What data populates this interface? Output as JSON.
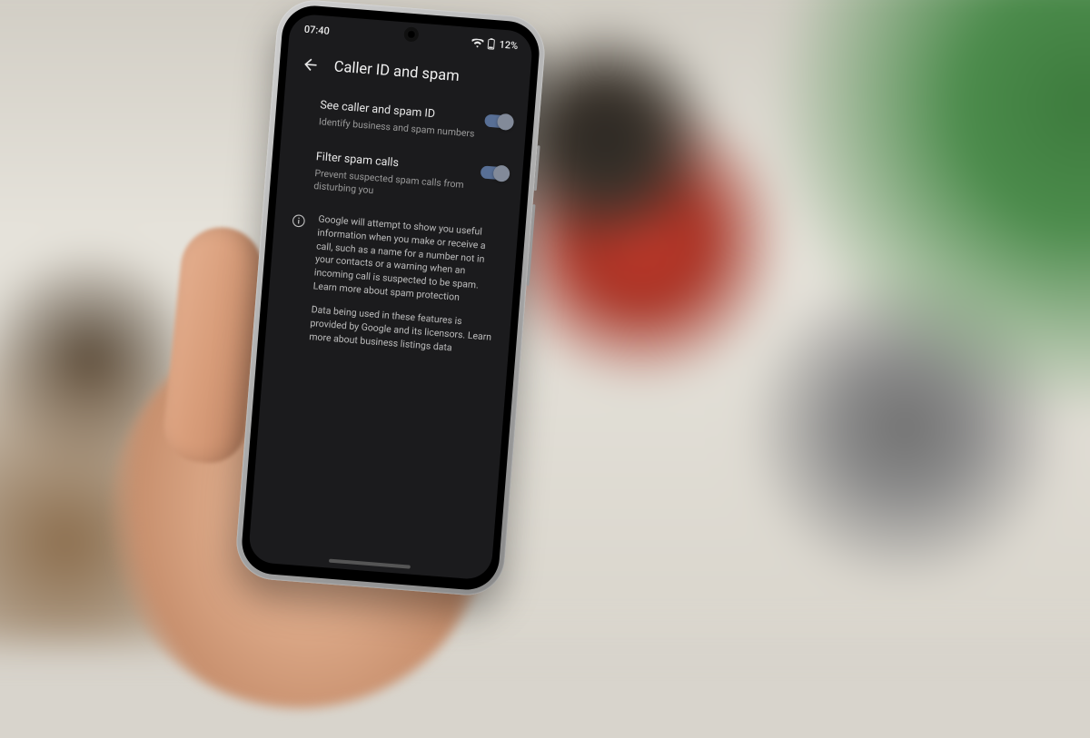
{
  "statusbar": {
    "time": "07:40",
    "battery_text": "12%"
  },
  "header": {
    "title": "Caller ID and spam"
  },
  "settings": [
    {
      "title": "See caller and spam ID",
      "subtitle": "Identify business and spam numbers",
      "enabled": true
    },
    {
      "title": "Filter spam calls",
      "subtitle": "Prevent suspected spam calls from disturbing you",
      "enabled": true
    }
  ],
  "info": {
    "para1": "Google will attempt to show you useful information when you make or receive a call, such as a name for a number not in your contacts or a warning when an incoming call is suspected to be spam. Learn more about spam protection",
    "para2": "Data being used in these features is provided by Google and its licensors. Learn more about business listings data"
  }
}
